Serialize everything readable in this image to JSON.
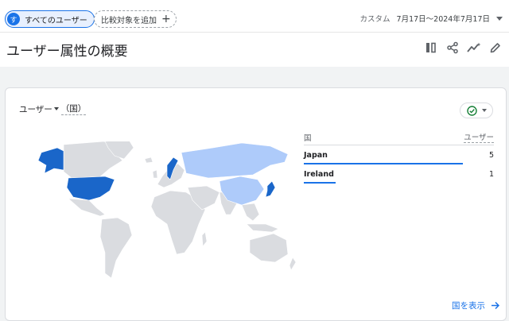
{
  "topbar": {
    "all_users_avatar": "す",
    "all_users_label": "すべてのユーザー",
    "add_comparison_label": "比較対象を追加",
    "date_range": {
      "label": "カスタム",
      "value": "7月17日～2024年7月17日"
    }
  },
  "page": {
    "title": "ユーザー属性の概要"
  },
  "toolbar": {
    "icons": [
      "compare-columns-icon",
      "share-icon",
      "insights-icon",
      "edit-pencil-icon"
    ]
  },
  "card": {
    "metric_label": "ユーザー",
    "dimension_label": "（国）",
    "status_icon": "check-circle-icon",
    "table": {
      "col_country": "国",
      "col_users": "ユーザー",
      "rows": [
        {
          "country": "Japan",
          "users": "5",
          "share": 1.0
        },
        {
          "country": "Ireland",
          "users": "1",
          "share": 0.2
        }
      ]
    },
    "view_link": "国を表示",
    "colors": {
      "highlight": "#1a66c9",
      "secondary": "#aecbfa",
      "land": "#dadce0"
    }
  }
}
